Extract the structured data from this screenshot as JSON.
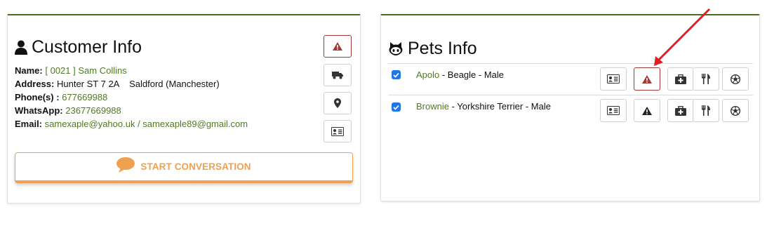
{
  "customer": {
    "title": "Customer Info",
    "name_label": "Name:",
    "name_value": "[ 0021 ] Sam Collins",
    "address_label": "Address:",
    "address_value": "Hunter ST 7 2A    Saldford (Manchester)",
    "phone_label": "Phone(s) :",
    "phone_value": "677669988",
    "whatsapp_label": "WhatsApp:",
    "whatsapp_value": "23677669988",
    "email_label": "Email:",
    "email_value": "samexaple@yahoo.uk / samexaple89@gmail.com",
    "side_buttons": [
      "alert-icon",
      "truck-icon",
      "location-pin-icon",
      "id-card-icon"
    ],
    "start_conversation_label": "START CONVERSATION"
  },
  "pets": {
    "title": "Pets Info",
    "rows": [
      {
        "checked": true,
        "name": "Apolo",
        "detail": " - Beagle - Male"
      },
      {
        "checked": true,
        "name": "Brownie",
        "detail": " - Yorkshire Terrier - Male"
      }
    ],
    "action_icons": [
      "id-card-icon",
      "alert-icon",
      "medical-kit-icon",
      "cutlery-icon",
      "soccer-ball-icon"
    ]
  },
  "colors": {
    "accent_green": "#4f7a21",
    "panel_border_top": "#4a6a1c",
    "alert_red": "#a33a3a",
    "orange": "#f0a050",
    "checkbox_blue": "#1f77e6",
    "annotation_red": "#e02020"
  }
}
